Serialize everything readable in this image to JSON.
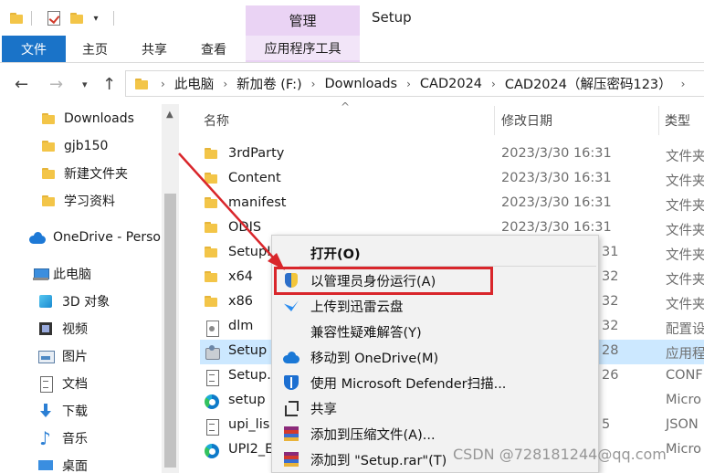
{
  "window": {
    "title": "Setup",
    "context_tab_header": "管理"
  },
  "ribbon": {
    "tabs": [
      "文件",
      "主页",
      "共享",
      "查看",
      "应用程序工具"
    ]
  },
  "address_bar": {
    "crumbs": [
      "此电脑",
      "新加卷 (F:)",
      "Downloads",
      "CAD2024",
      "CAD2024（解压密码123）"
    ]
  },
  "sidebar": {
    "items": [
      {
        "label": "Downloads",
        "icon": "folder-icon"
      },
      {
        "label": "gjb150",
        "icon": "folder-icon"
      },
      {
        "label": "新建文件夹",
        "icon": "folder-icon"
      },
      {
        "label": "学习资料",
        "icon": "folder-icon"
      },
      {
        "label": "OneDrive - Perso",
        "icon": "onedrive-icon"
      },
      {
        "label": "此电脑",
        "icon": "computer-icon"
      },
      {
        "label": "3D 对象",
        "icon": "3d-objects-icon"
      },
      {
        "label": "视频",
        "icon": "video-icon"
      },
      {
        "label": "图片",
        "icon": "pictures-icon"
      },
      {
        "label": "文档",
        "icon": "documents-icon"
      },
      {
        "label": "下载",
        "icon": "download-icon"
      },
      {
        "label": "音乐",
        "icon": "music-icon"
      },
      {
        "label": "桌面",
        "icon": "desktop-icon"
      }
    ]
  },
  "file_list": {
    "columns": {
      "name": "名称",
      "date": "修改日期",
      "type": "类型"
    },
    "rows": [
      {
        "name": "3rdParty",
        "date": "2023/3/30 16:31",
        "type": "文件夹",
        "icon": "folder-icon"
      },
      {
        "name": "Content",
        "date": "2023/3/30 16:31",
        "type": "文件夹",
        "icon": "folder-icon"
      },
      {
        "name": "manifest",
        "date": "2023/3/30 16:31",
        "type": "文件夹",
        "icon": "folder-icon"
      },
      {
        "name": "ODIS",
        "date": "2023/3/30 16:31",
        "type": "文件夹",
        "icon": "folder-icon"
      },
      {
        "name": "SetupI",
        "date": "31",
        "type": "文件夹",
        "icon": "folder-icon"
      },
      {
        "name": "x64",
        "date": "32",
        "type": "文件夹",
        "icon": "folder-icon"
      },
      {
        "name": "x86",
        "date": "32",
        "type": "文件夹",
        "icon": "folder-icon"
      },
      {
        "name": "dlm",
        "date": "32",
        "type": "配置设",
        "icon": "config-file-icon"
      },
      {
        "name": "Setup",
        "date": "28",
        "type": "应用程",
        "icon": "setup-app-icon"
      },
      {
        "name": "Setup.",
        "date": "26",
        "type": "CONF",
        "icon": "document-icon"
      },
      {
        "name": "setup",
        "date": "",
        "type": "Micro",
        "icon": "edge-icon"
      },
      {
        "name": "upi_lis",
        "date": "5",
        "type": "JSON",
        "icon": "document-icon"
      },
      {
        "name": "UPI2_E",
        "date": "",
        "type": "Micro",
        "icon": "edge-icon"
      }
    ],
    "selected_index": 8
  },
  "context_menu": {
    "items": [
      {
        "label": "打开(O)",
        "icon": "",
        "bold": true
      },
      {
        "label": "以管理员身份运行(A)",
        "icon": "uac-shield-icon"
      },
      {
        "label": "上传到迅雷云盘",
        "icon": "xunlei-icon"
      },
      {
        "label": "兼容性疑难解答(Y)",
        "icon": ""
      },
      {
        "label": "移动到 OneDrive(M)",
        "icon": "onedrive-icon"
      },
      {
        "label": "使用 Microsoft Defender扫描...",
        "icon": "defender-icon"
      },
      {
        "label": "共享",
        "icon": "share-icon"
      },
      {
        "label": "添加到压缩文件(A)...",
        "icon": "winrar-icon"
      },
      {
        "label": "添加到 \"Setup.rar\"(T)",
        "icon": "winrar-icon"
      }
    ],
    "highlighted_index": 1
  },
  "annotation": {
    "arrow_color": "#d9262b",
    "box_color": "#d9262b"
  },
  "watermark": "CSDN @728181244@qq.com",
  "colors": {
    "file_tab": "#1a73c8",
    "context_tab": "#ead3f4",
    "selection": "#cce8ff",
    "folder": "#f3c548"
  }
}
